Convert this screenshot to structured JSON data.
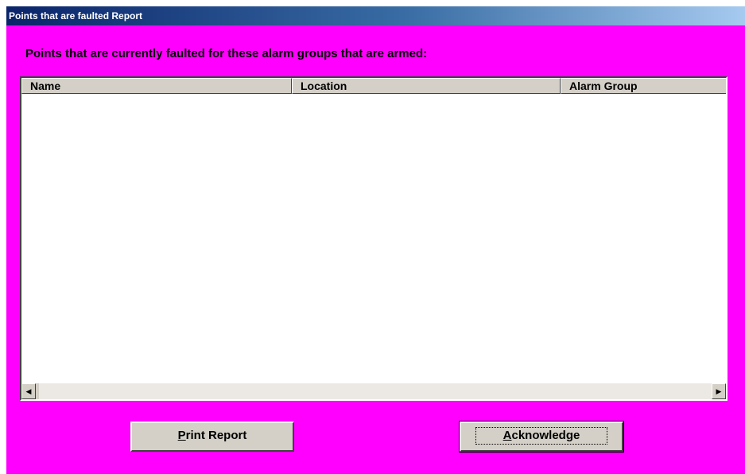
{
  "window": {
    "title": "Points that are faulted Report"
  },
  "heading": "Points that are currently faulted for these alarm groups that are armed:",
  "table": {
    "columns": [
      "Name",
      "Location",
      "Alarm Group"
    ],
    "rows": []
  },
  "buttons": {
    "print": {
      "accel": "P",
      "rest": "rint Report"
    },
    "acknowledge": {
      "accel": "A",
      "rest": "cknowledge"
    }
  },
  "colors": {
    "dialog_background": "#ff00ff",
    "title_bar_start": "#0a246a",
    "title_bar_end": "#a6caf0",
    "button_face": "#d4d0c8"
  },
  "icons": {
    "scroll_left": "scroll-left-arrow-icon",
    "scroll_right": "scroll-right-arrow-icon"
  }
}
